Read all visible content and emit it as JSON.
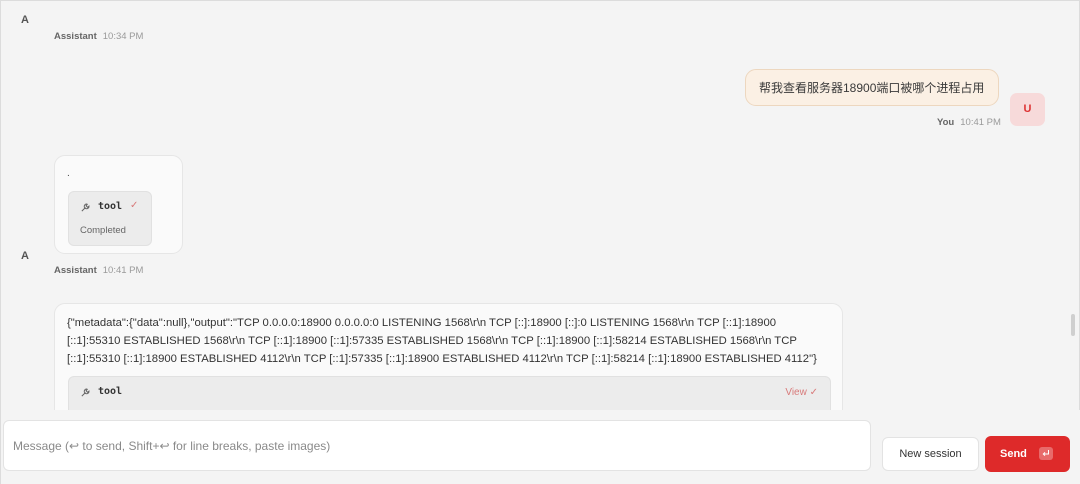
{
  "conversation": {
    "first_assistant": {
      "avatar": "A",
      "name": "Assistant",
      "time": "10:34 PM"
    },
    "user_message": {
      "text": "帮我查看服务器18900端口被哪个进程占用",
      "name": "You",
      "time": "10:41 PM",
      "avatar": "U"
    },
    "tool_call": {
      "marker": ".",
      "tool_name": "tool",
      "status": "Completed"
    },
    "second_assistant": {
      "avatar": "A",
      "name": "Assistant",
      "time": "10:41 PM"
    },
    "output_message": {
      "lines": [
        "{\"metadata\":{\"data\":null},\"output\":\"TCP 0.0.0.0:18900 0.0.0.0:0 LISTENING 1568\\r\\n TCP [::]:18900 [::]:0 LISTENING 1568\\r\\n TCP [::1]:18900",
        "[::1]:55310 ESTABLISHED 1568\\r\\n TCP [::1]:18900 [::1]:57335 ESTABLISHED 1568\\r\\n TCP [::1]:18900 [::1]:58214 ESTABLISHED 1568\\r\\n TCP",
        "[::1]:55310 [::1]:18900 ESTABLISHED 4112\\r\\n TCP [::1]:57335 [::1]:18900 ESTABLISHED 4112\\r\\n TCP [::1]:58214 [::1]:18900 ESTABLISHED 4112\"}"
      ],
      "tool_name": "tool",
      "view_label": "View"
    }
  },
  "composer": {
    "placeholder": "Message (↩ to send, Shift+↩ for line breaks, paste images)",
    "new_session_label": "New session",
    "send_label": "Send"
  },
  "colors": {
    "accent": "#de2a2a",
    "user_bubble": "#fbf0e4",
    "user_avatar_bg": "#f7dada"
  },
  "icons": {
    "tool": "wrench-icon",
    "check": "check-icon",
    "enter_key": "enter-key-icon"
  }
}
